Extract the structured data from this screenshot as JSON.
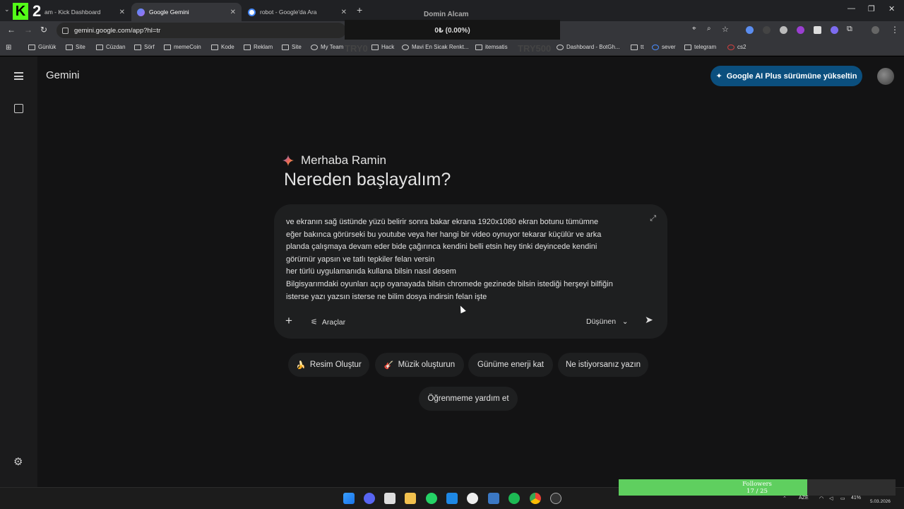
{
  "browser": {
    "tabs": [
      {
        "label": "am - Kick Dashboard",
        "active": false
      },
      {
        "label": "Google Gemini",
        "active": true
      },
      {
        "label": "robot - Google'da Ara",
        "active": false
      }
    ],
    "kick_number": "2",
    "url": "gemini.google.com/app?hl=tr",
    "bookmarks": [
      "Günlük",
      "Site",
      "Cüzdan",
      "Sörf",
      "memeCoin",
      "Kode",
      "Reklam",
      "Site",
      "My Team",
      "Hack",
      "Mavi En Sicak Renkt...",
      "itemsatis",
      "Dashboard - BotGh...",
      "tt",
      "sever",
      "telegram",
      "cs2"
    ]
  },
  "overlay": {
    "title": "Domin Alcam",
    "value": "0₺ (0.00%)",
    "ghost_left": "TRY0",
    "ghost_right": "TRY500"
  },
  "gemini": {
    "brand": "Gemini",
    "upgrade_label": "Google AI Plus sürümüne yükseltin",
    "greeting": "Merhaba Ramin",
    "headline": "Nereden başlayalım?",
    "prompt_text": "ve ekranın sağ üstünde yüzü belirir sonra bakar ekrana 1920x1080 ekran botunu tümümne\neğer bakınca görürseki bu youtube veya her hangi bir video oynuyor tekarar küçülür ve arka\nplanda çalışmaya devam eder bide çağırınca kendini belli etsin hey tinki deyincede kendini\ngörürnür yapsın ve tatlı tepkiler felan versin\nher türlü uygulamanıda kullana bilsin nasıl desem\nBilgisyarımdaki oyunları açıp oyanayada bilsin chromede gezinede bilsin istediği herşeyi bilfiğin\nisterse yazı yazsın isterse ne bilim dosya indirsin felan işte",
    "tools_label": "Araçlar",
    "mode_label": "Düşünen",
    "chips": [
      {
        "emoji": "🍌",
        "label": "Resim Oluştur"
      },
      {
        "emoji": "🎸",
        "label": "Müzik oluşturun"
      },
      {
        "emoji": "",
        "label": "Günüme enerji kat"
      },
      {
        "emoji": "",
        "label": "Ne istiyorsanız yazın"
      },
      {
        "emoji": "",
        "label": "Öğrenmeme yardım et"
      }
    ]
  },
  "taskbar": {
    "followers_label": "Followers",
    "followers_count": "17 / 25",
    "followers_progress": 0.68,
    "lang": "AZE",
    "battery": "41%",
    "date": "5.03.2026"
  },
  "colors": {
    "app_bg": "#131314",
    "upgrade_bg": "#0b4f7e",
    "followers_fill": "#5fcf5f",
    "kick_green": "#53fc18"
  }
}
